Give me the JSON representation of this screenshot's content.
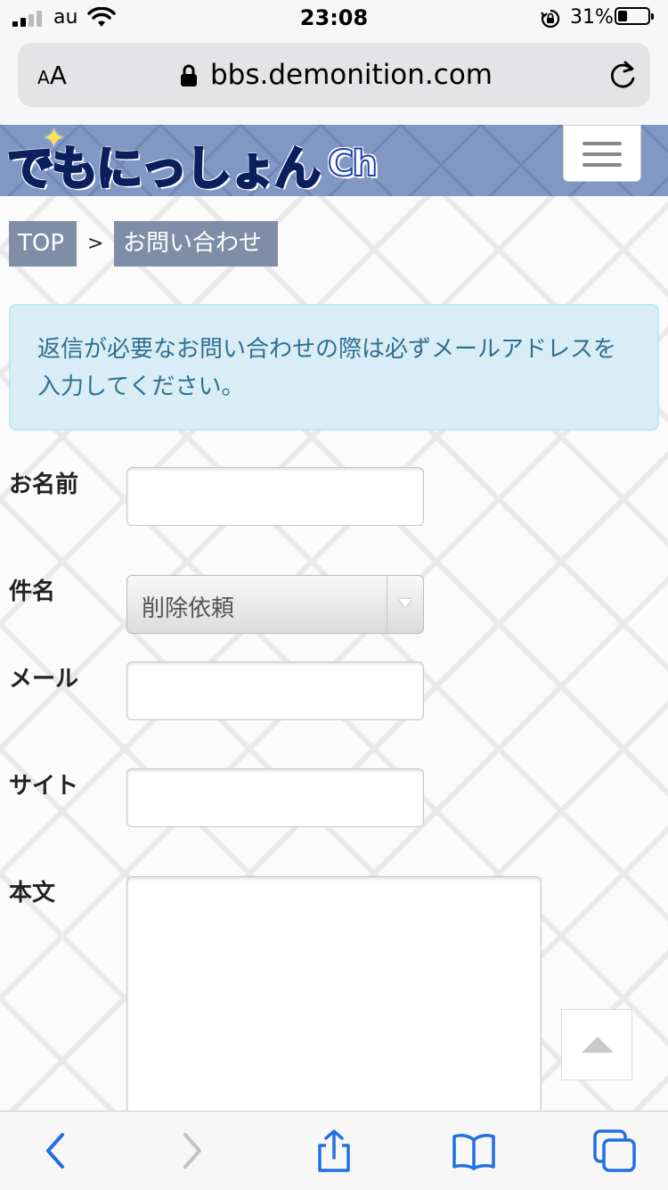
{
  "status_bar": {
    "carrier": "au",
    "time": "23:08",
    "battery": "31%"
  },
  "browser": {
    "text_size_small": "A",
    "text_size_large": "A",
    "url": "bbs.demonition.com"
  },
  "site": {
    "logo_main": "でもにっしょん",
    "logo_suffix": "Ch",
    "colors": {
      "header": "#8198c4",
      "crumb": "#7d8ea6",
      "alert_bg": "#d9edf7",
      "alert_text": "#31708f"
    }
  },
  "breadcrumb": {
    "home": "TOP",
    "separator": ">",
    "current": "お問い合わせ"
  },
  "notice": "返信が必要なお問い合わせの際は必ずメールアドレスを入力してください。",
  "form": {
    "name_label": "お名前",
    "subject_label": "件名",
    "subject_value": "削除依頼",
    "email_label": "メール",
    "site_label": "サイト",
    "body_label": "本文"
  },
  "icons": {
    "back": "chevron-left-icon",
    "forward": "chevron-right-icon",
    "share": "share-icon",
    "bookmarks": "book-icon",
    "tabs": "tabs-icon",
    "scroll_top": "triangle-up-icon",
    "menu": "hamburger-icon"
  }
}
